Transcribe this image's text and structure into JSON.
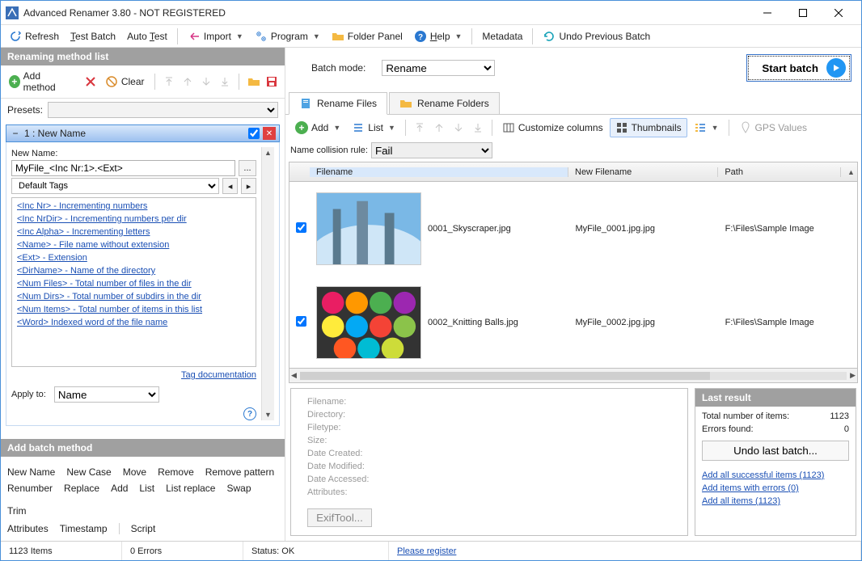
{
  "title": "Advanced Renamer 3.80 - NOT REGISTERED",
  "toolbar": {
    "refresh": "Refresh",
    "test_batch": "Test Batch",
    "auto_test": "Auto Test",
    "import": "Import",
    "program": "Program",
    "folder_panel": "Folder Panel",
    "help": "Help",
    "metadata": "Metadata",
    "undo_batch": "Undo Previous Batch"
  },
  "left": {
    "heading": "Renaming method list",
    "add_method": "Add method",
    "clear": "Clear",
    "presets_label": "Presets:",
    "method": {
      "index": "1 : New Name",
      "newname_label": "New Name:",
      "pattern": "MyFile_<Inc Nr:1>.<Ext>",
      "tags_select": "Default Tags",
      "tags": [
        "<Inc Nr> - Incrementing numbers",
        "<Inc NrDir> - Incrementing numbers per dir",
        "<Inc Alpha> - Incrementing letters",
        "<Name> - File name without extension",
        "<Ext> - Extension",
        "<DirName> - Name of the directory",
        "<Num Files> - Total number of files in the dir",
        "<Num Dirs> - Total number of subdirs in the dir",
        "<Num Items> - Total number of items in this list",
        "<Word> Indexed word of the file name"
      ],
      "tag_doc": "Tag documentation",
      "apply_to": "Apply to:",
      "apply_value": "Name"
    },
    "add_batch": {
      "heading": "Add batch method",
      "row1": [
        "New Name",
        "New Case",
        "Move",
        "Remove",
        "Remove pattern"
      ],
      "row2": [
        "Renumber",
        "Replace",
        "Add",
        "List",
        "List replace",
        "Swap",
        "Trim"
      ],
      "row3": [
        "Attributes",
        "Timestamp",
        "Script"
      ]
    }
  },
  "right": {
    "batch_mode_label": "Batch mode:",
    "batch_mode_value": "Rename",
    "start_batch": "Start batch",
    "tabs": {
      "files": "Rename Files",
      "folders": "Rename Folders"
    },
    "ftoolbar": {
      "add": "Add",
      "list": "List",
      "customize": "Customize columns",
      "thumbnails": "Thumbnails",
      "gps": "GPS Values"
    },
    "collision_label": "Name collision rule:",
    "collision_value": "Fail",
    "columns": {
      "filename": "Filename",
      "new_filename": "New Filename",
      "path": "Path"
    },
    "rows": [
      {
        "filename": "0001_Skyscraper.jpg",
        "newfilename": "MyFile_0001.jpg.jpg",
        "path": "F:\\Files\\Sample Image"
      },
      {
        "filename": "0002_Knitting Balls.jpg",
        "newfilename": "MyFile_0002.jpg.jpg",
        "path": "F:\\Files\\Sample Image"
      }
    ],
    "info": {
      "filename": "Filename:",
      "directory": "Directory:",
      "filetype": "Filetype:",
      "size": "Size:",
      "date_created": "Date Created:",
      "date_modified": "Date Modified:",
      "date_accessed": "Date Accessed:",
      "attributes": "Attributes:",
      "btn": "ExifTool..."
    },
    "result": {
      "heading": "Last result",
      "total_label": "Total number of items:",
      "total_value": "1123",
      "errors_label": "Errors found:",
      "errors_value": "0",
      "undo": "Undo last batch...",
      "link1": "Add all successful items (1123)",
      "link2": "Add items with errors (0)",
      "link3": "Add all items (1123)"
    }
  },
  "status": {
    "items": "1123 Items",
    "errors": "0 Errors",
    "status": "Status: OK",
    "register": "Please register"
  }
}
